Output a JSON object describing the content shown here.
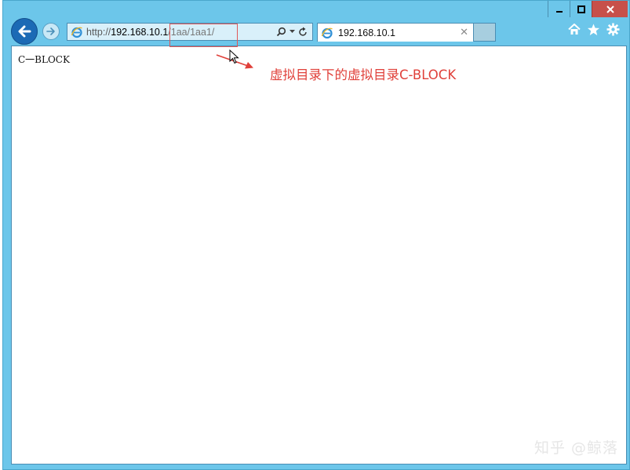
{
  "browser": {
    "url_scheme": "http://",
    "url_host": "192.168.10.1",
    "url_path": "/1aa/1aa1/",
    "tab_title": "192.168.10.1"
  },
  "page": {
    "body_text": "C一BLOCK"
  },
  "annotation": {
    "text": "虚拟目录下的虚拟目录C-BLOCK",
    "color": "#e0403a"
  },
  "watermark": {
    "text": "知乎 @鲸落"
  },
  "icons": [
    "back-arrow-icon",
    "forward-arrow-icon",
    "ie-logo-icon",
    "search-icon",
    "dropdown-icon",
    "refresh-icon",
    "home-icon",
    "favorites-star-icon",
    "gear-icon",
    "minimize-icon",
    "maximize-icon",
    "close-icon",
    "mouse-cursor-icon"
  ]
}
